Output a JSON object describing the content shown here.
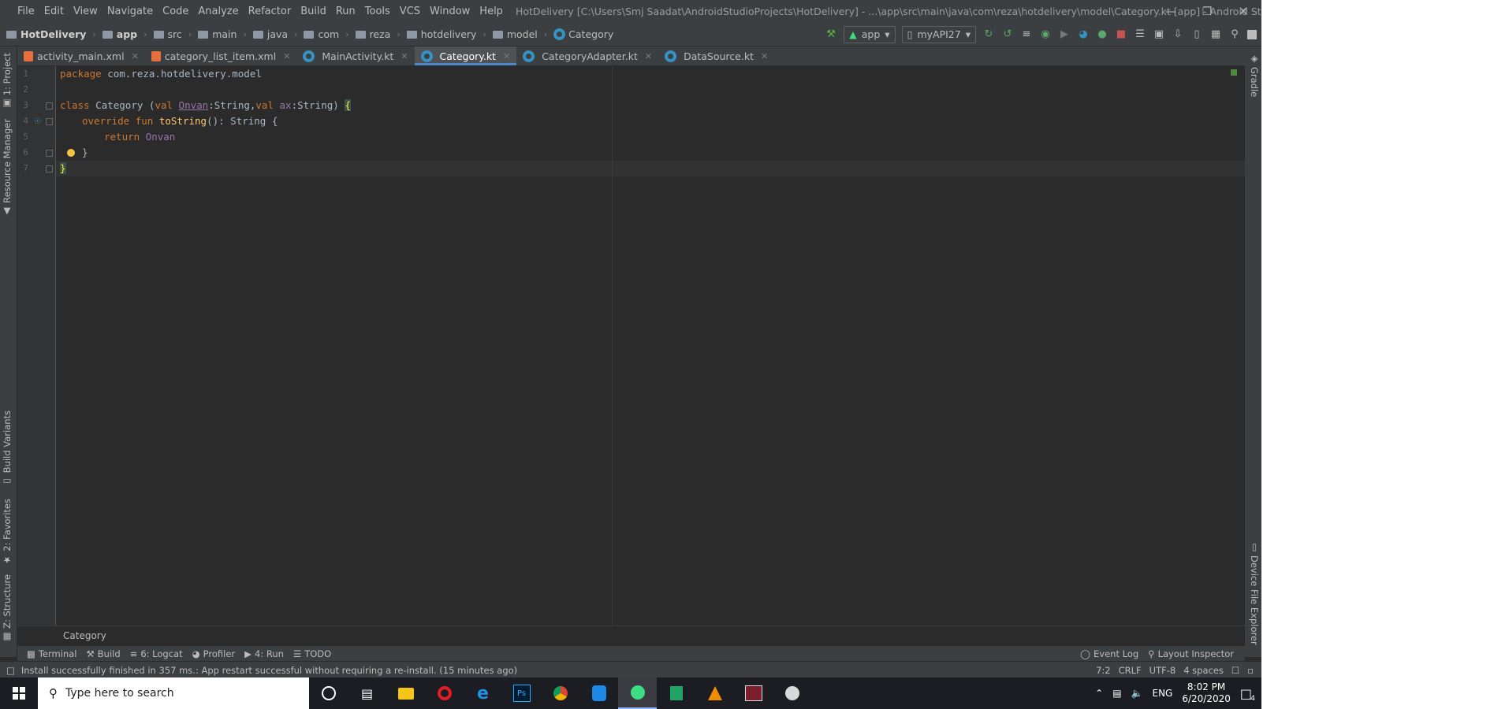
{
  "menubar": {
    "items": [
      "File",
      "Edit",
      "View",
      "Navigate",
      "Code",
      "Analyze",
      "Refactor",
      "Build",
      "Run",
      "Tools",
      "VCS",
      "Window",
      "Help"
    ],
    "window_title": "HotDelivery [C:\\Users\\Smj Saadat\\AndroidStudioProjects\\HotDelivery] - ...\\app\\src\\main\\java\\com\\reza\\hotdelivery\\model\\Category.kt [app] - Android Studio"
  },
  "breadcrumb": [
    "HotDelivery",
    "app",
    "src",
    "main",
    "java",
    "com",
    "reza",
    "hotdelivery",
    "model",
    "Category"
  ],
  "run_config": {
    "module": "app",
    "device": "myAPI27"
  },
  "left_tool_windows": [
    "1: Project",
    "Resource Manager",
    "Build Variants",
    "2: Favorites",
    "Z: Structure"
  ],
  "right_tool_windows": [
    "Gradle",
    "Device File Explorer"
  ],
  "tabs": [
    {
      "label": "activity_main.xml",
      "type": "xml",
      "active": false
    },
    {
      "label": "category_list_item.xml",
      "type": "xml",
      "active": false
    },
    {
      "label": "MainActivity.kt",
      "type": "kt",
      "active": false
    },
    {
      "label": "Category.kt",
      "type": "kt",
      "active": true
    },
    {
      "label": "CategoryAdapter.kt",
      "type": "kt",
      "active": false
    },
    {
      "label": "DataSource.kt",
      "type": "kt",
      "active": false
    }
  ],
  "editor": {
    "line_numbers": [
      "1",
      "2",
      "3",
      "4",
      "5",
      "6",
      "7"
    ],
    "lines": {
      "l1_kw": "package",
      "l1_rest": " com.reza.hotdelivery.model",
      "l3_kw": "class",
      "l3_name": " Category (",
      "l3_val1": "val ",
      "l3_p1": "Onvan",
      "l3_t1": ":String,",
      "l3_val2": "val ",
      "l3_p2": "ax",
      "l3_t2": ":String) ",
      "l3_brace": "{",
      "l4_kw": "override fun ",
      "l4_fn": "toString",
      "l4_rest": "(): String {",
      "l5_kw": "return ",
      "l5_p": "Onvan",
      "l6": "}",
      "l7": "}"
    },
    "footer_crumb": "Category"
  },
  "tool_window_bar": {
    "left": [
      "Terminal",
      "Build",
      "6: Logcat",
      "Profiler",
      "4: Run",
      "TODO"
    ],
    "right": [
      "Event Log",
      "Layout Inspector"
    ]
  },
  "status": {
    "message": "Install successfully finished in 357 ms.: App restart successful without requiring a re-install. (15 minutes ago)",
    "position": "7:2",
    "line_sep": "CRLF",
    "encoding": "UTF-8",
    "indent": "4 spaces"
  },
  "taskbar": {
    "search_placeholder": "Type here to search",
    "lang": "ENG",
    "time": "8:02 PM",
    "date": "6/20/2020",
    "notifications": "4"
  }
}
